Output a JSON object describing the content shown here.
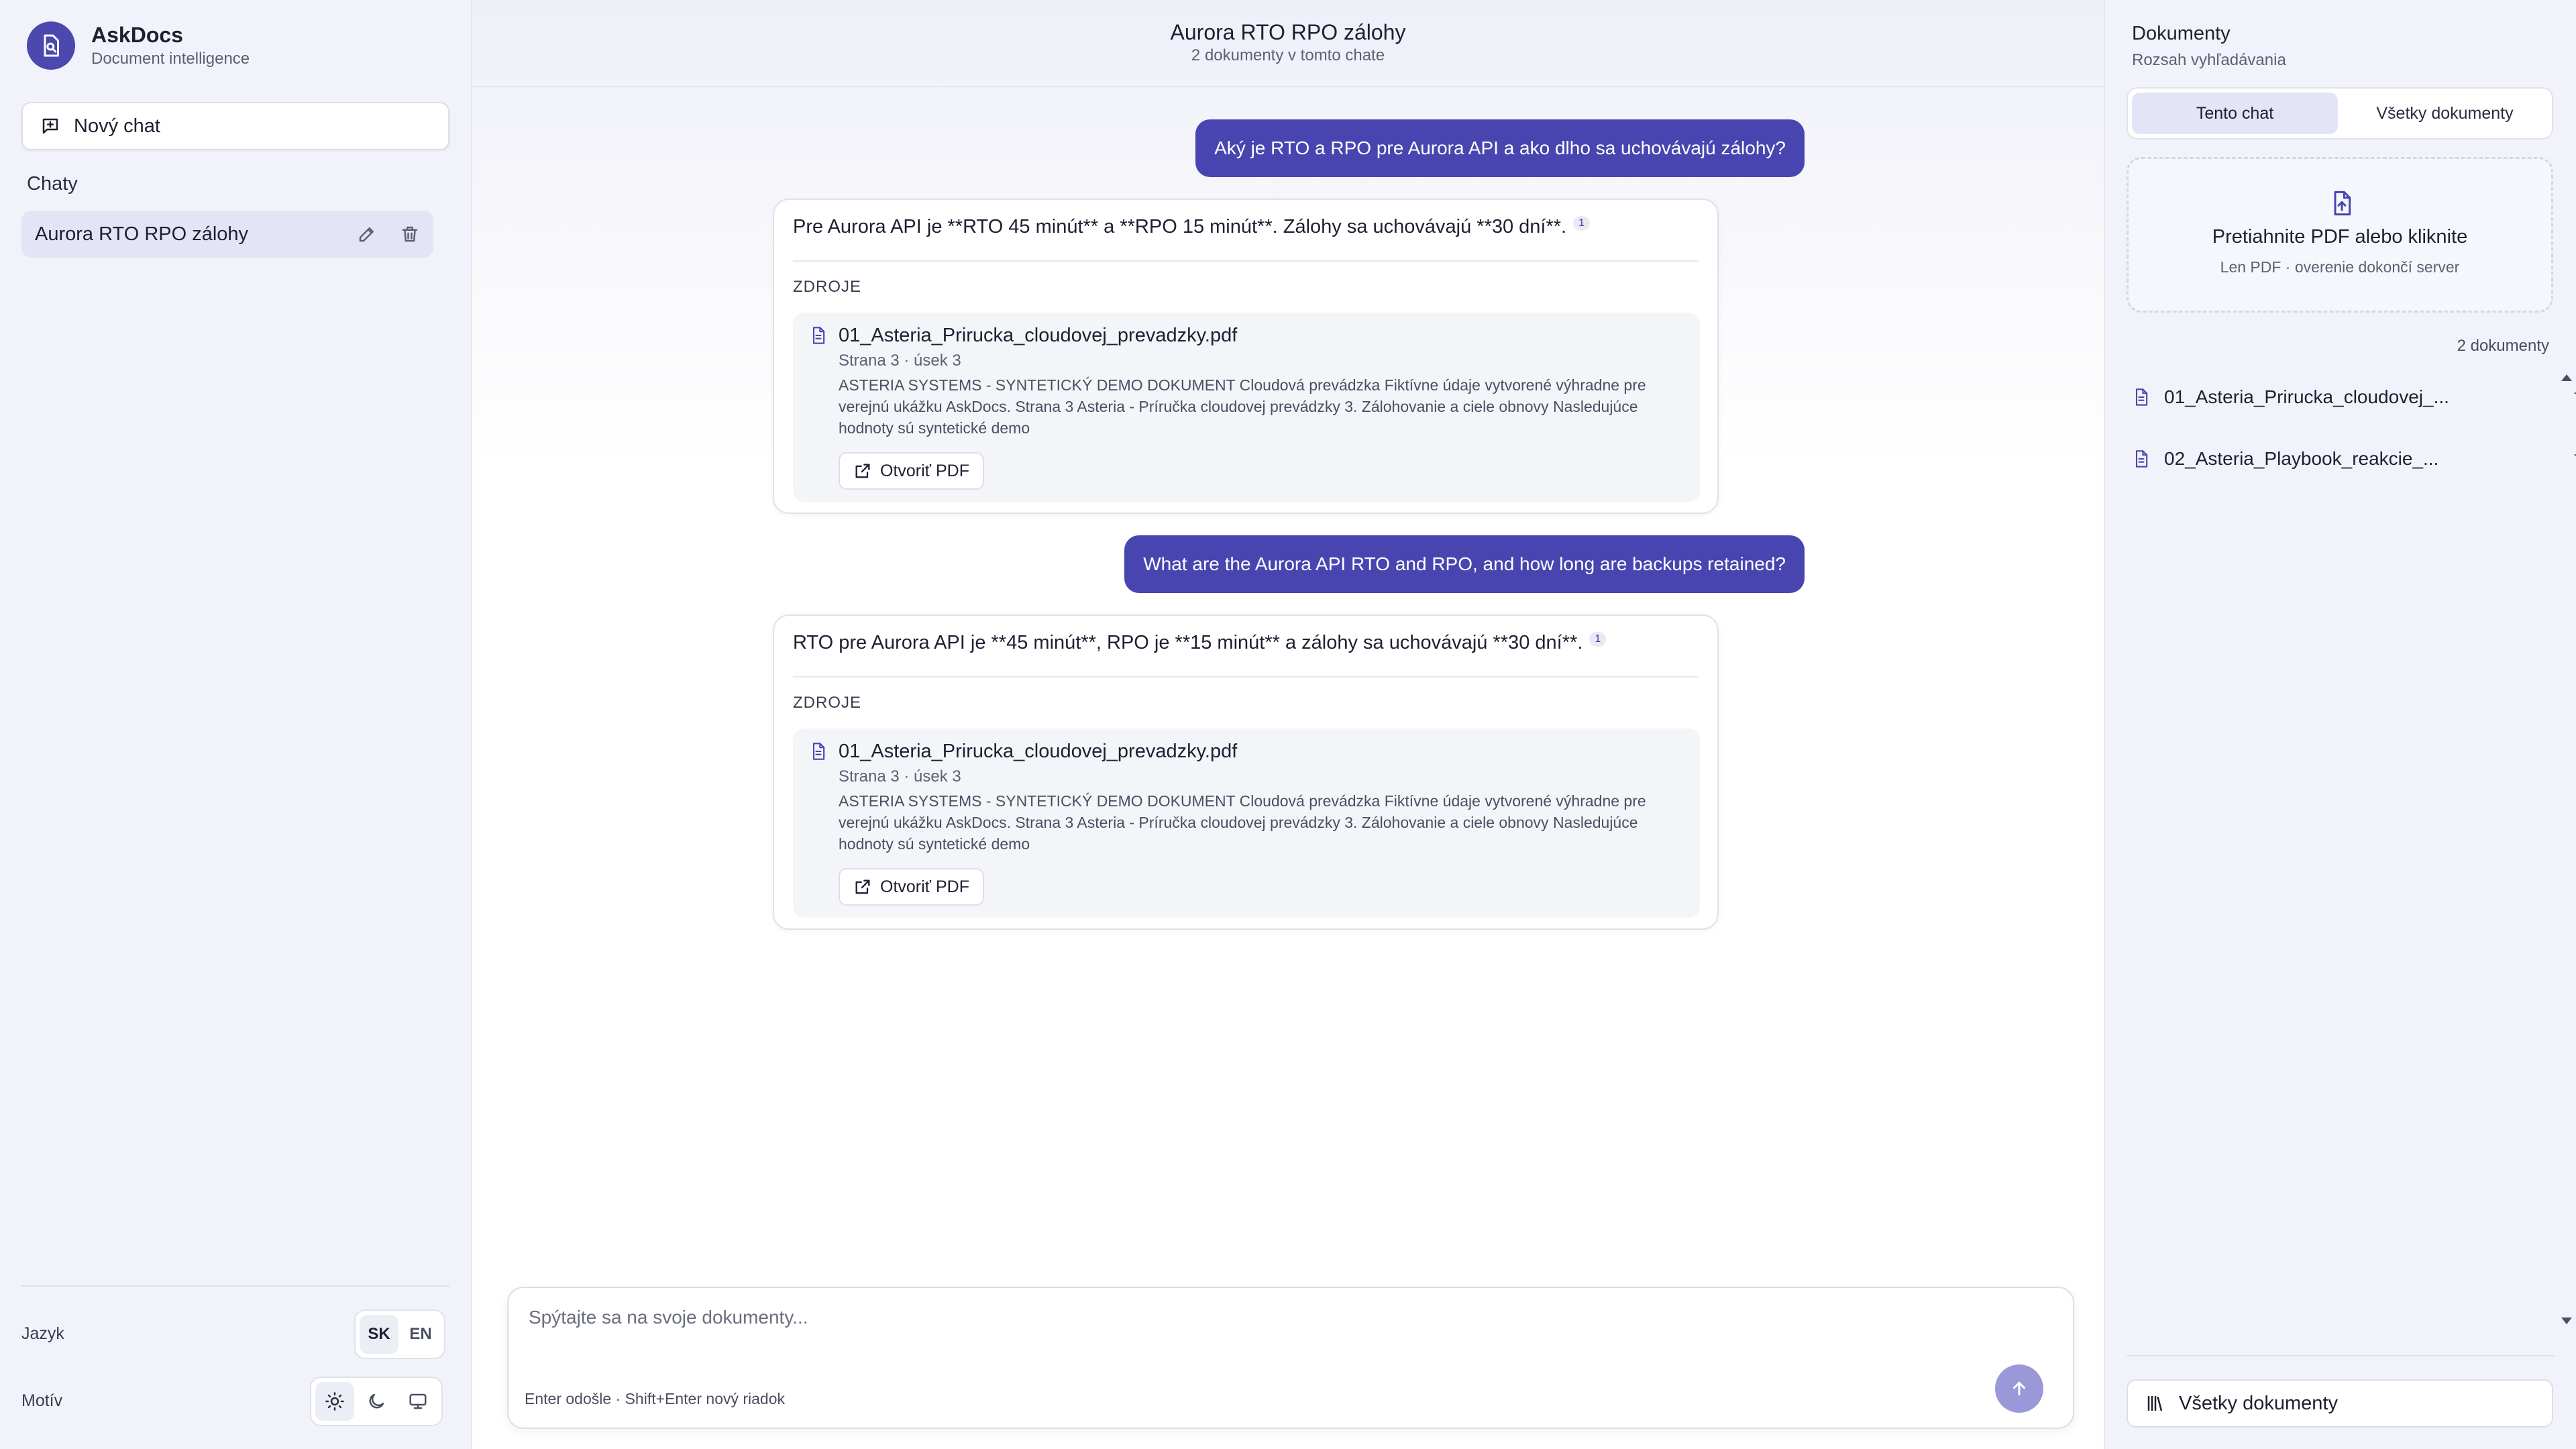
{
  "brand": {
    "name": "AskDocs",
    "subtitle": "Document intelligence"
  },
  "sidebar": {
    "new_chat_label": "Nový chat",
    "chats_heading": "Chaty",
    "chats": [
      {
        "label": "Aurora RTO RPO zálohy",
        "active": true
      }
    ],
    "language_label": "Jazyk",
    "languages": [
      {
        "label": "SK",
        "active": true
      },
      {
        "label": "EN",
        "active": false
      }
    ],
    "theme_label": "Motív",
    "themes": [
      {
        "icon": "sun-icon",
        "active": true
      },
      {
        "icon": "moon-icon",
        "active": false
      },
      {
        "icon": "monitor-icon",
        "active": false
      }
    ]
  },
  "header": {
    "title": "Aurora RTO RPO zálohy",
    "subtitle": "2 dokumenty v tomto chate"
  },
  "messages": [
    {
      "role": "user",
      "text": "Aký je RTO a RPO pre Aurora API a ako dlho sa uchovávajú zálohy?"
    },
    {
      "role": "assistant",
      "text": "Pre Aurora API je **RTO 45 minút** a **RPO 15 minút**. Zálohy sa uchovávajú **30 dní**.",
      "citation": "1",
      "sources_label": "ZDROJE",
      "source": {
        "title": "01_Asteria_Prirucka_cloudovej_prevadzky.pdf",
        "meta": "Strana 3 · úsek 3",
        "snippet": "ASTERIA SYSTEMS - SYNTETICKÝ DEMO DOKUMENT Cloudová prevádzka Fiktívne údaje vytvorené výhradne pre verejnú ukážku AskDocs. Strana 3 Asteria - Príručka cloudovej prevádzky 3. Zálohovanie a ciele obnovy Nasledujúce hodnoty sú syntetické demo",
        "open_label": "Otvoriť PDF"
      }
    },
    {
      "role": "user",
      "text": "What are the Aurora API RTO and RPO, and how long are backups retained?"
    },
    {
      "role": "assistant",
      "text": "RTO pre Aurora API je **45 minút**, RPO je **15 minút** a zálohy sa uchovávajú **30 dní**.",
      "citation": "1",
      "sources_label": "ZDROJE",
      "source": {
        "title": "01_Asteria_Prirucka_cloudovej_prevadzky.pdf",
        "meta": "Strana 3 · úsek 3",
        "snippet": "ASTERIA SYSTEMS - SYNTETICKÝ DEMO DOKUMENT Cloudová prevádzka Fiktívne údaje vytvorené výhradne pre verejnú ukážku AskDocs. Strana 3 Asteria - Príručka cloudovej prevádzky 3. Zálohovanie a ciele obnovy Nasledujúce hodnoty sú syntetické demo",
        "open_label": "Otvoriť PDF"
      }
    }
  ],
  "composer": {
    "placeholder": "Spýtajte sa na svoje dokumenty...",
    "hint": "Enter odošle · Shift+Enter nový riadok"
  },
  "docs_panel": {
    "title": "Dokumenty",
    "subtitle": "Rozsah vyhľadávania",
    "scope_tabs": [
      {
        "label": "Tento chat",
        "active": true
      },
      {
        "label": "Všetky dokumenty",
        "active": false
      }
    ],
    "dropzone_title": "Pretiahnite PDF alebo kliknite",
    "dropzone_sub": "Len PDF · overenie dokončí server",
    "count_label": "2 dokumenty",
    "documents": [
      {
        "name": "01_Asteria_Prirucka_cloudovej_..."
      },
      {
        "name": "02_Asteria_Playbook_reakcie_..."
      }
    ],
    "all_docs_label": "Všetky dokumenty"
  },
  "colors": {
    "accent": "#4845b0",
    "send_disabled": "#9a98d8",
    "sidebar_bg": "#f2f3fa"
  }
}
